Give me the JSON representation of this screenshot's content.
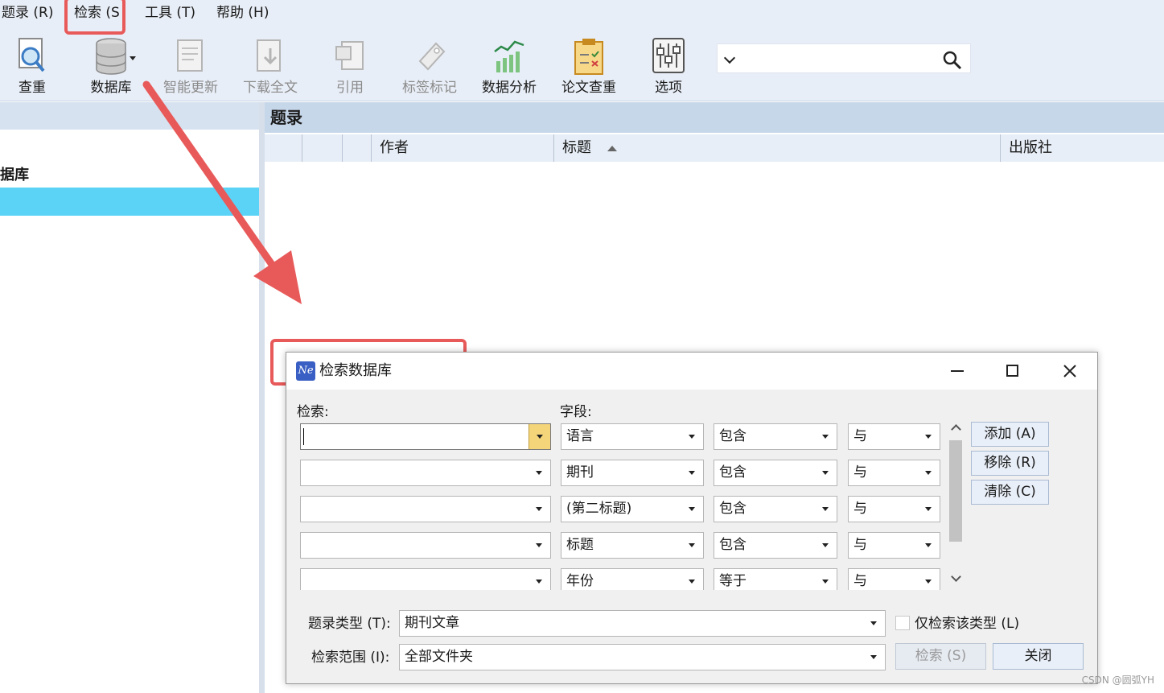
{
  "menubar": {
    "items": [
      "题录 (R)",
      "检索 (S",
      "工具 (T)",
      "帮助 (H)"
    ]
  },
  "toolbar": {
    "buttons": [
      {
        "label": "查重",
        "icon": "magnifier-document-icon",
        "enabled": true
      },
      {
        "label": "数据库",
        "icon": "database-icon",
        "enabled": true
      },
      {
        "label": "智能更新",
        "icon": "smart-update-icon",
        "enabled": false
      },
      {
        "label": "下载全文",
        "icon": "download-fulltext-icon",
        "enabled": false
      },
      {
        "label": "引用",
        "icon": "cite-icon",
        "enabled": false
      },
      {
        "label": "标签标记",
        "icon": "tag-icon",
        "enabled": false
      },
      {
        "label": "数据分析",
        "icon": "chart-analysis-icon",
        "enabled": true
      },
      {
        "label": "论文查重",
        "icon": "clipboard-check-icon",
        "enabled": true
      },
      {
        "label": "选项",
        "icon": "sliders-icon",
        "enabled": true
      }
    ],
    "search": {
      "value": ""
    }
  },
  "left_pane": {
    "item_label": "据库"
  },
  "list_pane": {
    "title": "题录",
    "columns": [
      "作者",
      "标题",
      "出版社"
    ],
    "sorted_column": "标题"
  },
  "dialog": {
    "title": "检索数据库",
    "search_label": "检索:",
    "field_label": "字段:",
    "rows": [
      {
        "field": "语言",
        "op": "包含",
        "logic": "与"
      },
      {
        "field": "期刊",
        "op": "包含",
        "logic": "与"
      },
      {
        "field": "(第二标题)",
        "op": "包含",
        "logic": "与"
      },
      {
        "field": "标题",
        "op": "包含",
        "logic": "与"
      },
      {
        "field": "年份",
        "op": "等于",
        "logic": "与"
      }
    ],
    "buttons": {
      "add": "添加 (A)",
      "remove": "移除 (R)",
      "clear": "清除 (C)",
      "search": "检索 (S)",
      "close": "关闭"
    },
    "ref_type_label": "题录类型 (T):",
    "ref_type_value": "期刊文章",
    "only_type_label": "仅检索该类型 (L)",
    "scope_label": "检索范围 (I):",
    "scope_value": "全部文件夹"
  },
  "watermark": "CSDN @圆弧YH",
  "colors": {
    "highlight": "#e85a5a",
    "selection": "#5bd3f7",
    "header": "#c7d7ea"
  }
}
